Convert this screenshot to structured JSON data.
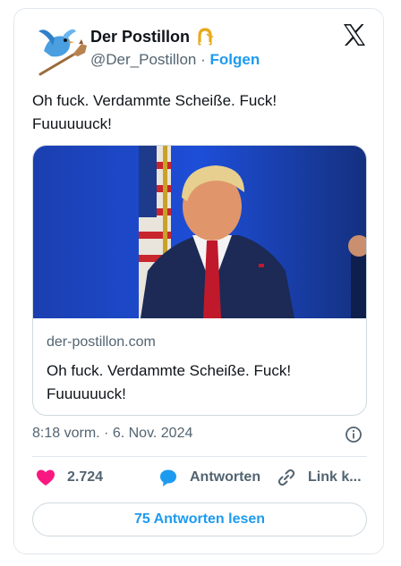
{
  "account": {
    "name": "Der Postillon",
    "handle": "@Der_Postillon",
    "separator": "·",
    "follow_label": "Folgen"
  },
  "icons": {
    "avatar": "blue-bird-on-hobby-horse",
    "badge": "horseshoe-icon",
    "platform": "x-logo-icon",
    "info": "info-icon",
    "like": "heart-icon",
    "reply": "speech-bubble-icon",
    "link": "link-icon"
  },
  "tweet": {
    "text": "Oh fuck. Verdammte Scheiße. Fuck!\nFuuuuuuck!",
    "time": "8:18 vorm.",
    "date_separator": "·",
    "date": "6. Nov. 2024"
  },
  "link_card": {
    "domain": "der-postillon.com",
    "title": "Oh fuck. Verdammte Scheiße. Fuck!\nFuuuuuuck!"
  },
  "actions": {
    "like_count": "2.724",
    "reply_label": "Antworten",
    "link_label": "Link k..."
  },
  "read_replies_label": "75 Antworten lesen",
  "colors": {
    "accent": "#1d9bf0",
    "like": "#f91880",
    "text": "#0f1419",
    "muted": "#536471"
  }
}
